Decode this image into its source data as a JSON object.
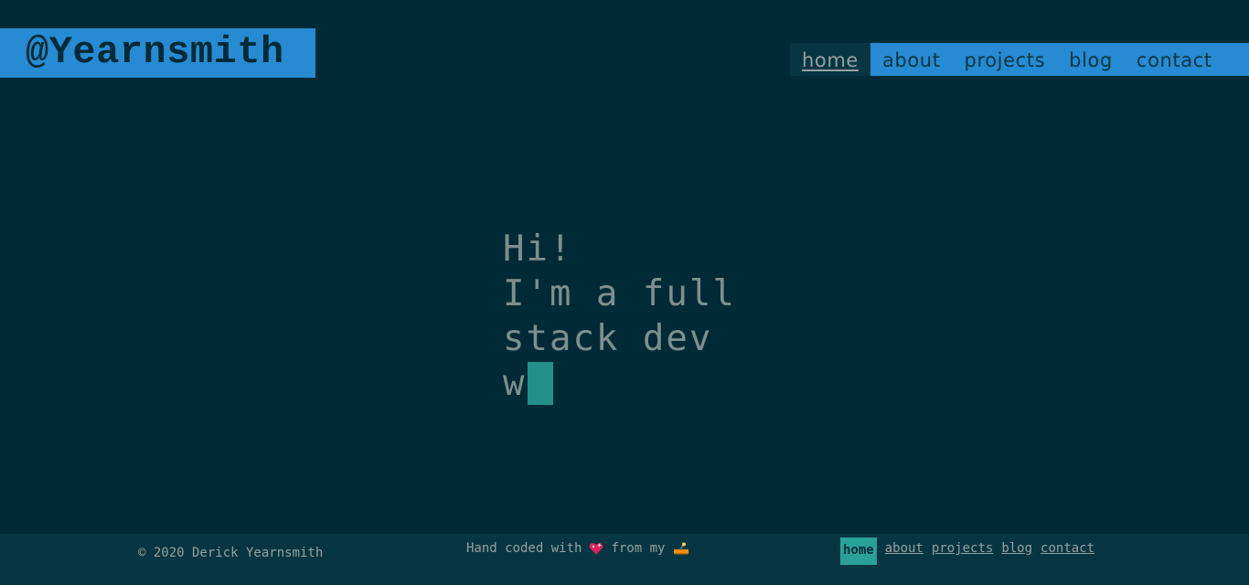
{
  "brand": {
    "handle": "@Yearnsmith"
  },
  "topnav": {
    "items": [
      {
        "label": "home",
        "active": true
      },
      {
        "label": "about",
        "active": false
      },
      {
        "label": "projects",
        "active": false
      },
      {
        "label": "blog",
        "active": false
      },
      {
        "label": "contact",
        "active": false
      }
    ]
  },
  "hero": {
    "lines": [
      "Hi!",
      "I'm a full",
      "stack dev",
      "w"
    ]
  },
  "footer": {
    "copyright": "© 2020 Derick Yearnsmith",
    "handcoded_prefix": "Hand coded with",
    "handcoded_middle": "from my",
    "heart_icon": "sparkling-heart-icon",
    "laptop_icon": "laptop-icon",
    "nav": [
      {
        "label": "home",
        "active": true
      },
      {
        "label": "about",
        "active": false
      },
      {
        "label": "projects",
        "active": false
      },
      {
        "label": "blog",
        "active": false
      },
      {
        "label": "contact",
        "active": false
      }
    ]
  },
  "colors": {
    "background": "#002b36",
    "panel": "#073642",
    "accent_blue": "#268bd2",
    "accent_cyan": "#2aa198",
    "text": "#93a1a1"
  }
}
